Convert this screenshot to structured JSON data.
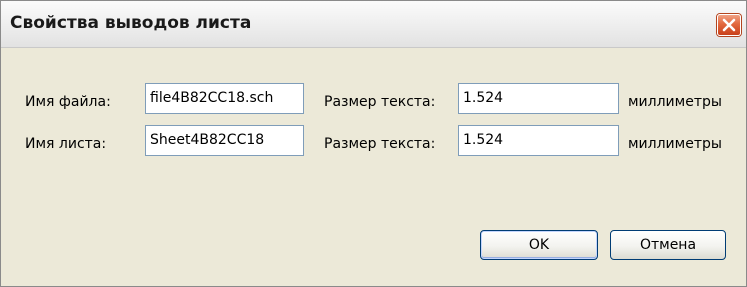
{
  "window": {
    "title": "Свойства выводов листа"
  },
  "form": {
    "rows": [
      {
        "name_label": "Имя файла:",
        "name_value": "file4B82CC18.sch",
        "size_label": "Размер текста:",
        "size_value": "1.524",
        "unit_label": "миллиметры"
      },
      {
        "name_label": "Имя листа:",
        "name_value": "Sheet4B82CC18",
        "size_label": "Размер текста:",
        "size_value": "1.524",
        "unit_label": "миллиметры"
      }
    ]
  },
  "buttons": {
    "ok_label": "OK",
    "cancel_label": "Отмена"
  },
  "colors": {
    "dialog_background": "#ece9d8",
    "field_border": "#7f9db9",
    "close_button": "#e2693f"
  },
  "icons": {
    "close": "close-icon"
  }
}
